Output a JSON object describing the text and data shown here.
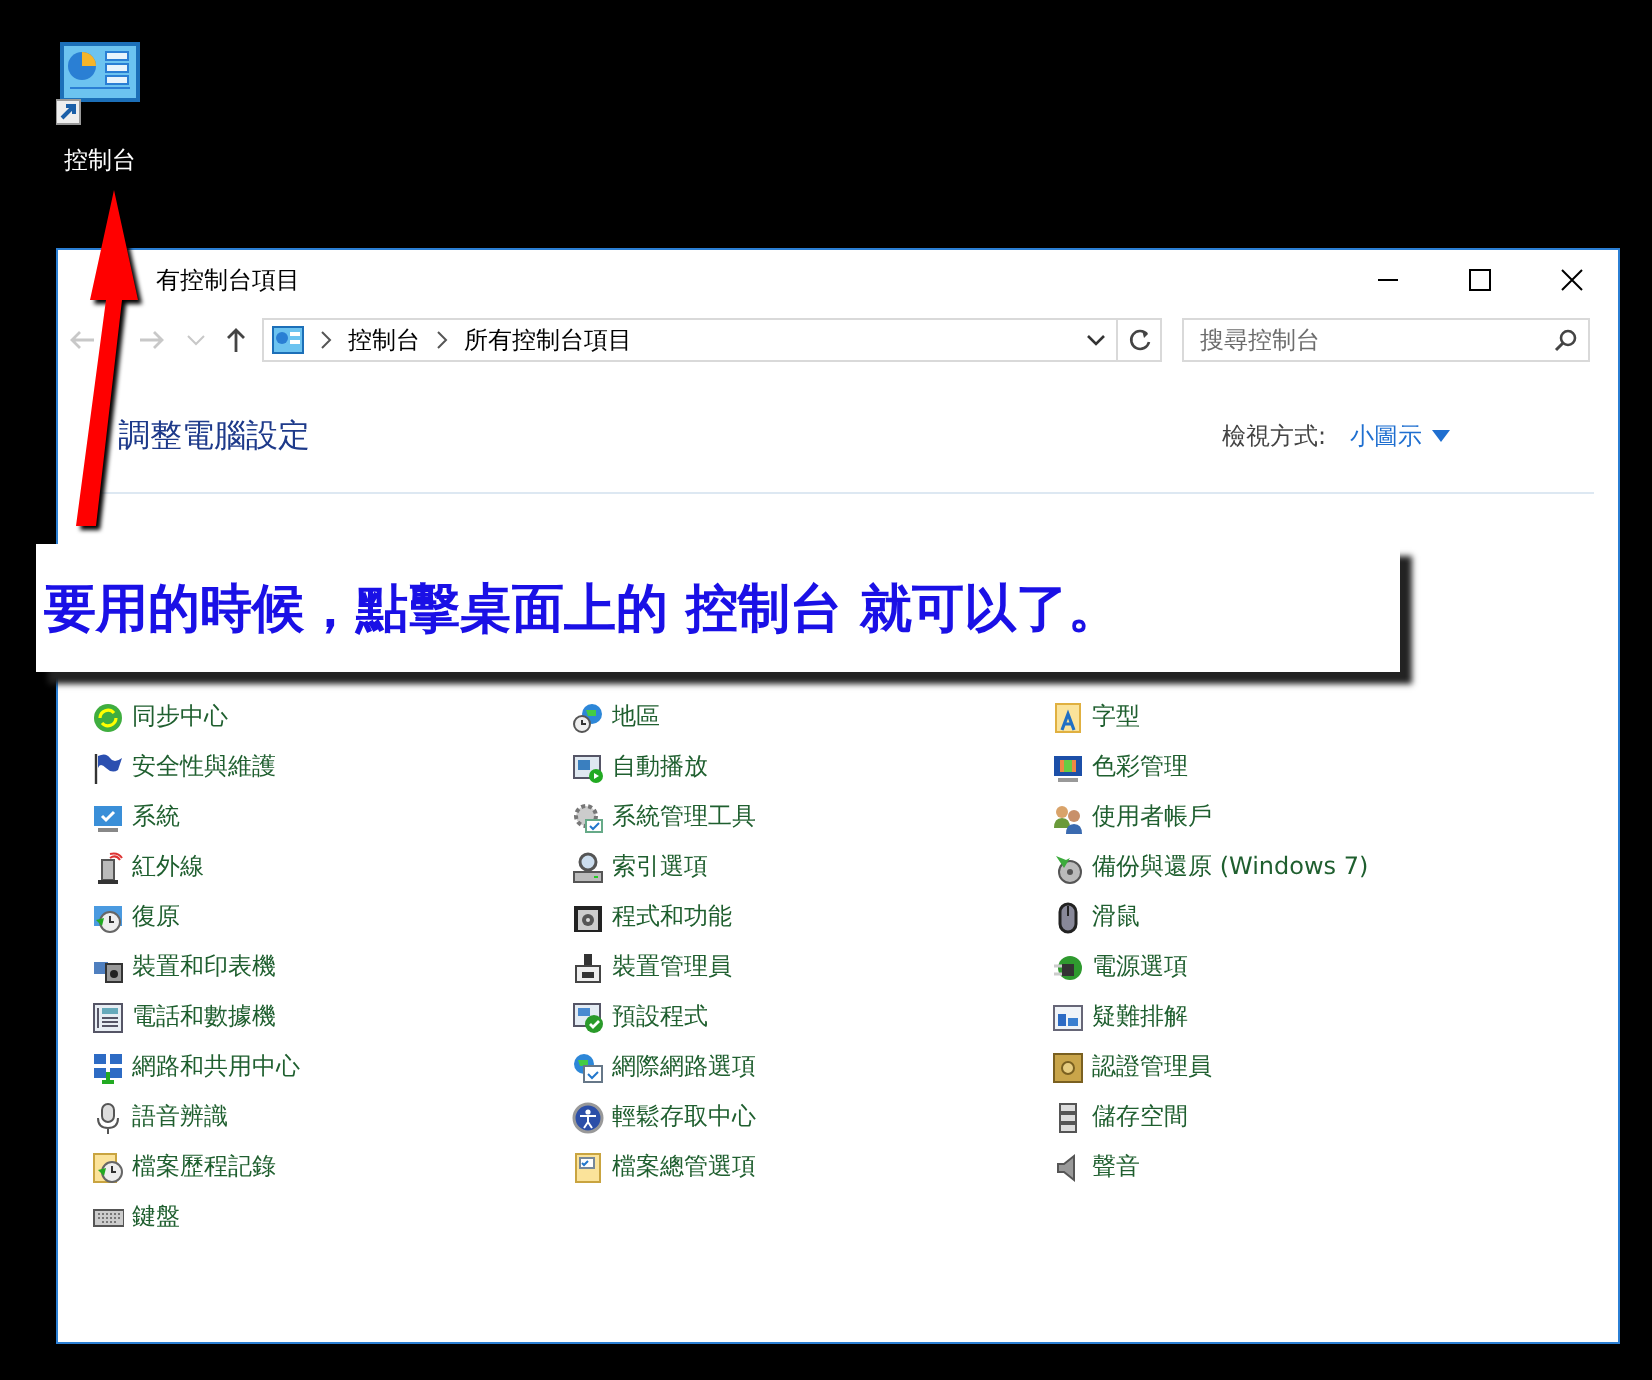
{
  "desktop_icon": {
    "label": "控制台"
  },
  "window": {
    "title": "有控制台項目",
    "nav_buttons": [
      {
        "kind": "back",
        "disabled": true
      },
      {
        "kind": "forward",
        "disabled": true
      },
      {
        "kind": "recent",
        "disabled": true
      },
      {
        "kind": "up",
        "disabled": false
      }
    ],
    "address": [
      "控制台",
      "所有控制台項目"
    ],
    "search": {
      "placeholder": "搜尋控制台"
    },
    "heading": "調整電腦設定",
    "view_by": {
      "label": "檢視方式:",
      "value": "小圖示"
    },
    "columns": [
      [
        {
          "label": "同步中心"
        },
        {
          "label": "安全性與維護"
        },
        {
          "label": "系統"
        },
        {
          "label": "紅外線"
        },
        {
          "label": "復原"
        },
        {
          "label": "裝置和印表機"
        },
        {
          "label": "電話和數據機"
        },
        {
          "label": "網路和共用中心"
        },
        {
          "label": "語音辨識"
        },
        {
          "label": "檔案歷程記錄"
        },
        {
          "label": "鍵盤"
        }
      ],
      [
        {
          "label": "地區"
        },
        {
          "label": "自動播放"
        },
        {
          "label": "系統管理工具"
        },
        {
          "label": "索引選項"
        },
        {
          "label": "程式和功能"
        },
        {
          "label": "裝置管理員"
        },
        {
          "label": "預設程式"
        },
        {
          "label": "網際網路選項"
        },
        {
          "label": "輕鬆存取中心"
        },
        {
          "label": "檔案總管選項"
        }
      ],
      [
        {
          "label": "字型"
        },
        {
          "label": "色彩管理"
        },
        {
          "label": "使用者帳戶"
        },
        {
          "label": "備份與還原 (Windows 7)"
        },
        {
          "label": "滑鼠"
        },
        {
          "label": "電源選項"
        },
        {
          "label": "疑難排解"
        },
        {
          "label": "認證管理員"
        },
        {
          "label": "儲存空間"
        },
        {
          "label": "聲音"
        }
      ]
    ]
  },
  "callout": {
    "text": "要用的時候，點擊桌面上的 控制台 就可以了。"
  }
}
